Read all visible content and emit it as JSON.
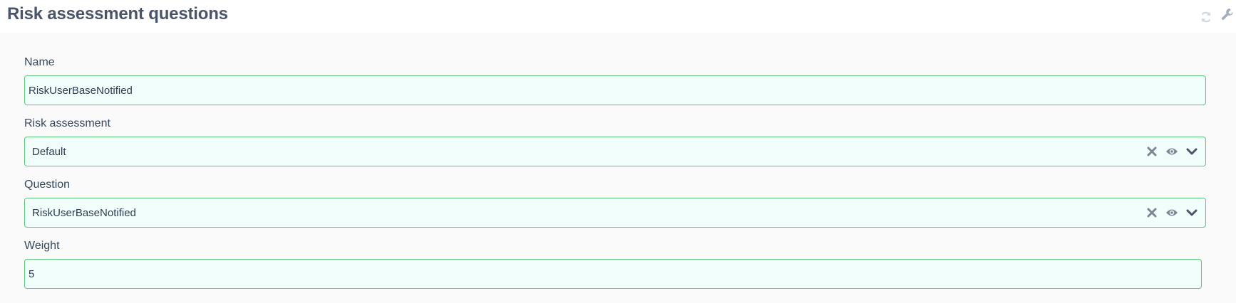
{
  "header": {
    "title": "Risk assessment questions",
    "tools": [
      {
        "icon": "refresh-icon"
      },
      {
        "icon": "wrench-icon"
      }
    ]
  },
  "form": {
    "name": {
      "label": "Name",
      "value": "RiskUserBaseNotified"
    },
    "risk_assessment": {
      "label": "Risk assessment",
      "value": "Default",
      "icons": [
        "clear-icon",
        "eye-icon",
        "chevron-down-icon"
      ]
    },
    "question": {
      "label": "Question",
      "value": "RiskUserBaseNotified",
      "icons": [
        "clear-icon",
        "eye-icon",
        "chevron-down-icon"
      ]
    },
    "weight": {
      "label": "Weight",
      "value": "5"
    }
  },
  "colors": {
    "title": "#4a5568",
    "field_border": "#5cc77a",
    "field_bg": "#f0fdfb",
    "icon": "#7b8794",
    "header_icon": "#cbd5e0"
  }
}
